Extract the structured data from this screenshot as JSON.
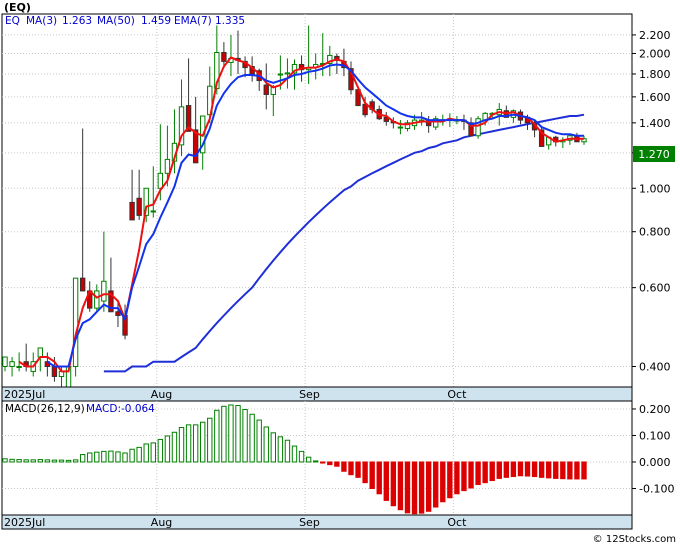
{
  "colors": {
    "background": "#ffffff",
    "axis_band": "#cfe3ef",
    "grid": "#c8c8c8",
    "up_candle": "#008000",
    "down_candle": "#cc0000",
    "ma3": "#ee1111",
    "ma50": "#1f2fd8",
    "ema7": "#1133ee",
    "macd_pos": "#008000",
    "macd_neg": "#dd0000",
    "last_price_box": "#008000",
    "legend_text": "#0000cc"
  },
  "header": {
    "symbol": "(EQ)",
    "legend_symbol": "EQ",
    "ma3_label": "MA(3)",
    "ma3_value": "1.263",
    "ma50_label": "MA(50)",
    "ma50_value": "1.459",
    "ema7_label": "EMA(7)",
    "ema7_value": "1.335",
    "last_price": "1.270"
  },
  "macd_header": {
    "label": "MACD(26,12,9)",
    "value_label": "MACD:-0.064"
  },
  "watermark": "© 12Stocks.com",
  "chart_data": [
    {
      "type": "candlestick",
      "name": "price",
      "scale": "log",
      "ylim": [
        0.36,
        2.45
      ],
      "yticks": [
        "2.200",
        "2.000",
        "1.800",
        "1.600",
        "1.400",
        "1.200",
        "1.000",
        "0.800",
        "0.600",
        "0.400"
      ],
      "date_labels": [
        "2025Jul",
        "Aug",
        "Sep",
        "Oct"
      ],
      "dates": [
        "2025-07-01",
        "2025-07-02",
        "2025-07-03",
        "2025-07-07",
        "2025-07-08",
        "2025-07-09",
        "2025-07-10",
        "2025-07-11",
        "2025-07-14",
        "2025-07-15",
        "2025-07-16",
        "2025-07-17",
        "2025-07-18",
        "2025-07-21",
        "2025-07-22",
        "2025-07-23",
        "2025-07-24",
        "2025-07-25",
        "2025-07-28",
        "2025-07-29",
        "2025-07-30",
        "2025-07-31",
        "2025-08-01",
        "2025-08-04",
        "2025-08-05",
        "2025-08-06",
        "2025-08-07",
        "2025-08-08",
        "2025-08-11",
        "2025-08-12",
        "2025-08-13",
        "2025-08-14",
        "2025-08-15",
        "2025-08-18",
        "2025-08-19",
        "2025-08-20",
        "2025-08-21",
        "2025-08-22",
        "2025-08-25",
        "2025-08-26",
        "2025-08-27",
        "2025-08-28",
        "2025-08-29",
        "2025-09-02",
        "2025-09-03",
        "2025-09-04",
        "2025-09-05",
        "2025-09-08",
        "2025-09-09",
        "2025-09-10",
        "2025-09-11",
        "2025-09-12",
        "2025-09-15",
        "2025-09-16",
        "2025-09-17",
        "2025-09-18",
        "2025-09-19",
        "2025-09-22",
        "2025-09-23",
        "2025-09-24",
        "2025-09-25",
        "2025-09-26",
        "2025-09-29",
        "2025-09-30",
        "2025-10-01",
        "2025-10-02",
        "2025-10-03",
        "2025-10-06",
        "2025-10-07",
        "2025-10-08",
        "2025-10-09",
        "2025-10-10",
        "2025-10-13",
        "2025-10-14",
        "2025-10-15",
        "2025-10-16",
        "2025-10-17",
        "2025-10-20",
        "2025-10-21",
        "2025-10-22",
        "2025-10-23",
        "2025-10-24",
        "2025-10-27"
      ],
      "open": [
        0.4,
        0.4,
        0.4,
        0.41,
        0.39,
        0.42,
        0.41,
        0.4,
        0.38,
        0.36,
        0.4,
        0.63,
        0.59,
        0.54,
        0.56,
        0.59,
        0.53,
        0.52,
        0.93,
        0.95,
        0.87,
        0.89,
        1.0,
        1.08,
        1.15,
        1.25,
        1.53,
        1.35,
        1.2,
        1.46,
        1.67,
        2.01,
        1.91,
        1.95,
        1.92,
        1.87,
        1.83,
        1.7,
        1.62,
        1.79,
        1.8,
        1.81,
        1.89,
        1.84,
        1.86,
        1.89,
        1.9,
        1.97,
        1.92,
        1.85,
        1.66,
        1.54,
        1.56,
        1.5,
        1.44,
        1.41,
        1.37,
        1.36,
        1.38,
        1.41,
        1.42,
        1.37,
        1.42,
        1.42,
        1.42,
        1.42,
        1.4,
        1.31,
        1.42,
        1.46,
        1.46,
        1.49,
        1.44,
        1.48,
        1.44,
        1.4,
        1.35,
        1.25,
        1.3,
        1.27,
        1.28,
        1.31,
        1.27
      ],
      "high": [
        0.42,
        0.42,
        0.43,
        0.45,
        0.43,
        0.44,
        0.43,
        0.42,
        0.4,
        0.39,
        0.43,
        1.36,
        0.62,
        0.61,
        0.8,
        0.7,
        0.56,
        0.55,
        1.1,
        1.1,
        0.98,
        1.12,
        1.39,
        1.38,
        1.5,
        1.75,
        1.95,
        1.6,
        1.35,
        1.87,
        2.31,
        2.12,
        2.2,
        2.25,
        1.97,
        1.97,
        1.85,
        1.9,
        1.7,
        1.98,
        1.95,
        1.94,
        1.98,
        2.31,
        2.0,
        2.22,
        2.08,
        2.0,
        2.05,
        1.92,
        1.68,
        1.6,
        1.58,
        1.53,
        1.48,
        1.44,
        1.42,
        1.42,
        1.46,
        1.48,
        1.45,
        1.45,
        1.46,
        1.47,
        1.45,
        1.46,
        1.44,
        1.45,
        1.48,
        1.48,
        1.55,
        1.53,
        1.5,
        1.5,
        1.46,
        1.42,
        1.38,
        1.3,
        1.31,
        1.3,
        1.31,
        1.33,
        1.31
      ],
      "low": [
        0.39,
        0.38,
        0.39,
        0.39,
        0.38,
        0.39,
        0.38,
        0.37,
        0.36,
        0.35,
        0.38,
        0.6,
        0.53,
        0.53,
        0.53,
        0.53,
        0.49,
        0.46,
        0.85,
        0.85,
        0.84,
        0.86,
        0.94,
        1.01,
        1.08,
        1.18,
        1.41,
        1.25,
        1.1,
        1.4,
        1.62,
        1.88,
        1.78,
        1.8,
        1.77,
        1.73,
        1.65,
        1.5,
        1.45,
        1.66,
        1.67,
        1.66,
        1.73,
        1.71,
        1.75,
        1.78,
        1.78,
        1.8,
        1.78,
        1.62,
        1.53,
        1.44,
        1.47,
        1.42,
        1.38,
        1.36,
        1.32,
        1.34,
        1.35,
        1.38,
        1.33,
        1.35,
        1.38,
        1.37,
        1.39,
        1.35,
        1.31,
        1.29,
        1.38,
        1.43,
        1.38,
        1.44,
        1.4,
        1.39,
        1.35,
        1.3,
        1.24,
        1.22,
        1.24,
        1.23,
        1.25,
        1.28,
        1.25
      ],
      "close": [
        0.42,
        0.41,
        0.4,
        0.4,
        0.41,
        0.44,
        0.4,
        0.38,
        0.39,
        0.4,
        0.63,
        0.59,
        0.54,
        0.59,
        0.62,
        0.53,
        0.52,
        0.47,
        0.85,
        0.87,
        1.0,
        0.89,
        1.08,
        1.16,
        1.26,
        1.52,
        1.34,
        1.14,
        1.45,
        1.69,
        2.01,
        1.92,
        1.95,
        1.93,
        1.86,
        1.8,
        1.74,
        1.62,
        1.68,
        1.8,
        1.81,
        1.89,
        1.84,
        1.86,
        1.89,
        1.9,
        1.98,
        1.93,
        1.86,
        1.66,
        1.53,
        1.46,
        1.5,
        1.43,
        1.41,
        1.4,
        1.37,
        1.4,
        1.42,
        1.42,
        1.38,
        1.43,
        1.42,
        1.43,
        1.42,
        1.41,
        1.31,
        1.43,
        1.47,
        1.47,
        1.5,
        1.44,
        1.49,
        1.42,
        1.4,
        1.35,
        1.24,
        1.3,
        1.27,
        1.28,
        1.31,
        1.27,
        1.29
      ],
      "series": [
        {
          "name": "MA(3)",
          "values": [
            null,
            null,
            0.41,
            0.4,
            0.4,
            0.42,
            0.42,
            0.41,
            0.39,
            0.39,
            0.47,
            0.54,
            0.59,
            0.57,
            0.58,
            0.58,
            0.56,
            0.51,
            0.61,
            0.73,
            0.91,
            0.92,
            0.99,
            1.04,
            1.17,
            1.31,
            1.37,
            1.33,
            1.31,
            1.43,
            1.72,
            1.87,
            1.96,
            1.93,
            1.91,
            1.86,
            1.8,
            1.72,
            1.68,
            1.7,
            1.76,
            1.83,
            1.85,
            1.86,
            1.86,
            1.88,
            1.92,
            1.94,
            1.92,
            1.82,
            1.68,
            1.55,
            1.5,
            1.46,
            1.45,
            1.41,
            1.39,
            1.39,
            1.4,
            1.41,
            1.41,
            1.41,
            1.41,
            1.43,
            1.42,
            1.42,
            1.38,
            1.38,
            1.4,
            1.46,
            1.48,
            1.47,
            1.48,
            1.45,
            1.44,
            1.39,
            1.33,
            1.3,
            1.27,
            1.28,
            1.29,
            1.29,
            1.29
          ]
        },
        {
          "name": "MA(50)",
          "values": [
            null,
            null,
            null,
            null,
            null,
            null,
            null,
            null,
            null,
            null,
            null,
            null,
            null,
            null,
            0.39,
            0.39,
            0.39,
            0.39,
            0.4,
            0.4,
            0.4,
            0.41,
            0.41,
            0.41,
            0.41,
            0.42,
            0.43,
            0.44,
            0.46,
            0.48,
            0.5,
            0.52,
            0.54,
            0.56,
            0.58,
            0.6,
            0.63,
            0.66,
            0.69,
            0.72,
            0.75,
            0.78,
            0.81,
            0.84,
            0.87,
            0.9,
            0.93,
            0.96,
            0.99,
            1.01,
            1.04,
            1.06,
            1.08,
            1.1,
            1.12,
            1.14,
            1.16,
            1.18,
            1.2,
            1.21,
            1.23,
            1.24,
            1.26,
            1.27,
            1.28,
            1.3,
            1.31,
            1.32,
            1.33,
            1.34,
            1.35,
            1.36,
            1.37,
            1.38,
            1.39,
            1.4,
            1.41,
            1.42,
            1.43,
            1.44,
            1.45,
            1.45,
            1.46
          ]
        },
        {
          "name": "EMA(7)",
          "values": [
            null,
            null,
            null,
            null,
            null,
            null,
            0.41,
            0.4,
            0.4,
            0.4,
            0.46,
            0.5,
            0.51,
            0.53,
            0.55,
            0.54,
            0.54,
            0.51,
            0.6,
            0.67,
            0.75,
            0.79,
            0.86,
            0.93,
            1.01,
            1.14,
            1.19,
            1.18,
            1.25,
            1.36,
            1.53,
            1.63,
            1.71,
            1.77,
            1.79,
            1.79,
            1.78,
            1.74,
            1.72,
            1.74,
            1.76,
            1.79,
            1.8,
            1.82,
            1.83,
            1.85,
            1.88,
            1.89,
            1.88,
            1.83,
            1.75,
            1.68,
            1.63,
            1.58,
            1.53,
            1.5,
            1.47,
            1.45,
            1.44,
            1.44,
            1.42,
            1.42,
            1.42,
            1.42,
            1.42,
            1.42,
            1.39,
            1.4,
            1.42,
            1.43,
            1.45,
            1.45,
            1.46,
            1.45,
            1.44,
            1.42,
            1.37,
            1.35,
            1.33,
            1.32,
            1.32,
            1.31,
            1.31
          ]
        }
      ]
    },
    {
      "type": "bar",
      "name": "MACD(26,12,9)",
      "ylim": [
        -0.2,
        0.23
      ],
      "yticks": [
        "0.200",
        "0.100",
        "0.000",
        "-0.100"
      ],
      "date_labels": [
        "2025Jul",
        "Aug",
        "Sep",
        "Oct"
      ],
      "values": [
        0.012,
        0.01,
        0.009,
        0.008,
        0.008,
        0.009,
        0.008,
        0.007,
        0.007,
        0.006,
        0.008,
        0.028,
        0.034,
        0.037,
        0.04,
        0.041,
        0.038,
        0.034,
        0.048,
        0.055,
        0.068,
        0.072,
        0.085,
        0.098,
        0.112,
        0.13,
        0.14,
        0.14,
        0.15,
        0.165,
        0.195,
        0.21,
        0.215,
        0.213,
        0.198,
        0.18,
        0.158,
        0.132,
        0.11,
        0.095,
        0.082,
        0.06,
        0.04,
        0.018,
        0.004,
        -0.004,
        -0.01,
        -0.016,
        -0.035,
        -0.048,
        -0.058,
        -0.078,
        -0.1,
        -0.12,
        -0.145,
        -0.165,
        -0.18,
        -0.192,
        -0.195,
        -0.193,
        -0.186,
        -0.17,
        -0.15,
        -0.135,
        -0.12,
        -0.108,
        -0.098,
        -0.085,
        -0.078,
        -0.07,
        -0.062,
        -0.058,
        -0.055,
        -0.052,
        -0.053,
        -0.055,
        -0.058,
        -0.06,
        -0.062,
        -0.063,
        -0.064,
        -0.064,
        -0.064
      ]
    }
  ]
}
